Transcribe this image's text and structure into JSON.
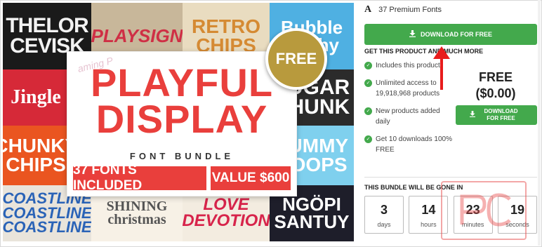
{
  "hero": {
    "tiles": [
      "THELOR CEVISK",
      "PLAYSIGN",
      "RETRO CHIPS",
      "Bubble Sushy",
      "Jingle",
      "SUGAR CHUNK",
      "CHUNKY CHIPS",
      "YUMMY BOOPS",
      "COASTLINE COASTLINE COASTLINE",
      "SHINING christmas",
      "LOVE DEVOTION",
      "NGÖPI SANTUY"
    ],
    "card_title": "PLAYFUL DISPLAY",
    "card_subtitle": "FONT BUNDLE",
    "fonts_included": "37 FONTS INCLUDED",
    "value": "VALUE $600",
    "free_badge": "FREE",
    "watermark": "aming P"
  },
  "sidebar": {
    "font_icon": "A",
    "font_count": "37 Premium Fonts",
    "download_button": "DOWNLOAD FOR FREE",
    "get_title": "GET THIS PRODUCT AND MUCH MORE",
    "benefits": [
      "Includes this product",
      "Unlimited access to 19,918,968 products",
      "New products added daily",
      "Get 10 downloads 100% FREE"
    ],
    "price_label": "FREE",
    "price_amount": "($0.00)",
    "download_button_small": "DOWNLOAD FOR FREE",
    "gone_title": "THIS BUNDLE WILL BE GONE IN",
    "countdown": [
      {
        "num": "3",
        "label": "days"
      },
      {
        "num": "14",
        "label": "hours"
      },
      {
        "num": "23",
        "label": "minutes"
      },
      {
        "num": "19",
        "label": "seconds"
      }
    ]
  },
  "colors": {
    "green": "#43a94c",
    "red": "#e93f3c",
    "gold": "#b89a3d",
    "annotation": "#e81c1c"
  }
}
